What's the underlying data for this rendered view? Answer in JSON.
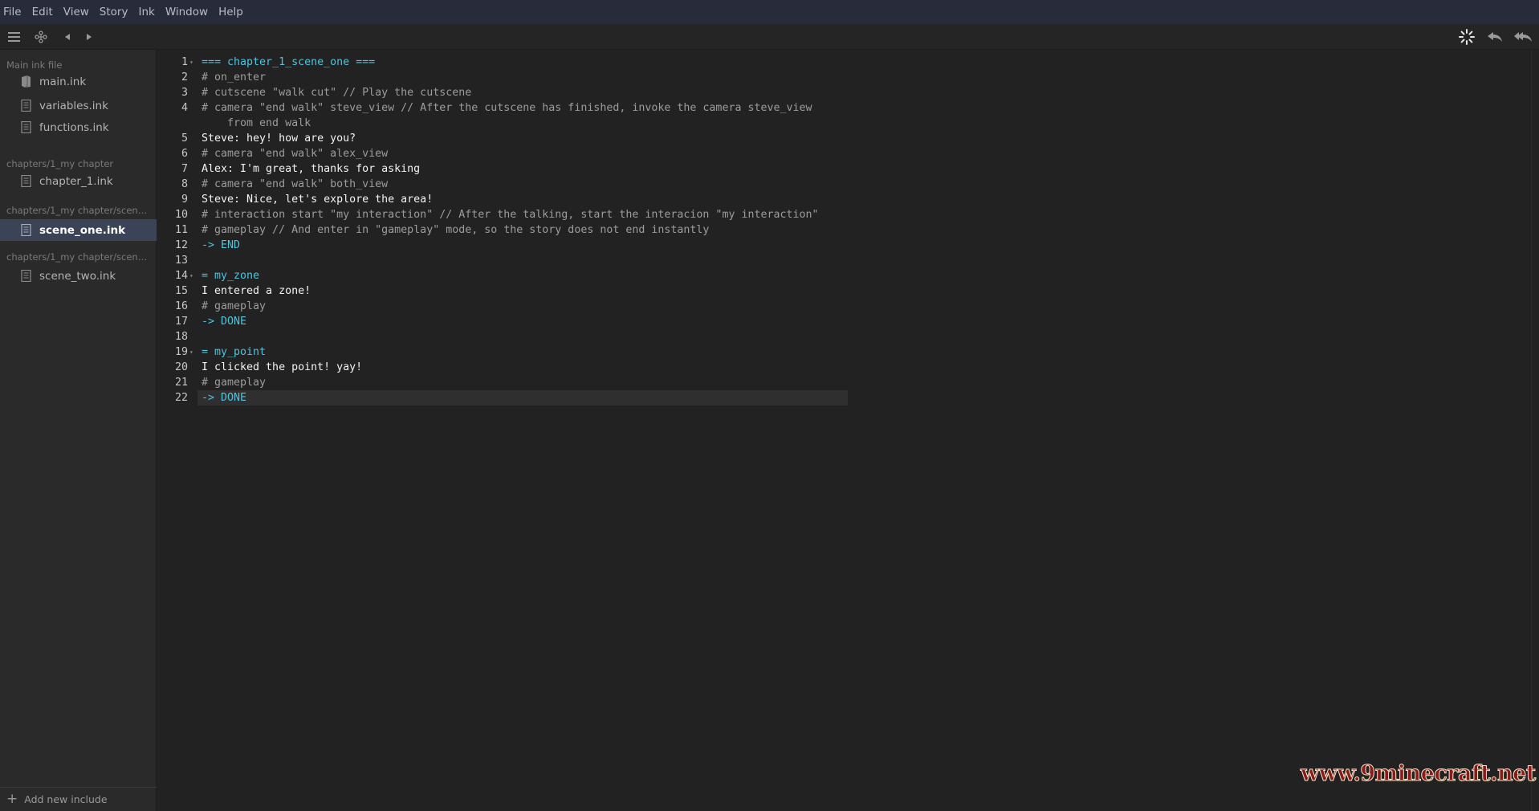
{
  "menubar": {
    "items": [
      "File",
      "Edit",
      "View",
      "Story",
      "Ink",
      "Window",
      "Help"
    ]
  },
  "toolbar": {
    "left_icons": [
      "hamburger-menu-icon",
      "navigation-graph-icon",
      "back-arrow-icon",
      "forward-arrow-icon"
    ],
    "right_icons": [
      "loading-spinner-icon",
      "rewind-one-icon",
      "rewind-all-icon"
    ]
  },
  "sidebar": {
    "groups": [
      {
        "label": "Main ink file",
        "files": [
          {
            "name": "main.ink",
            "icon": "main-file-icon",
            "active": false
          }
        ]
      },
      {
        "label": "",
        "files": [
          {
            "name": "variables.ink",
            "icon": "file-icon",
            "active": false
          },
          {
            "name": "functions.ink",
            "icon": "file-icon",
            "active": false
          }
        ]
      },
      {
        "label": "chapters/1_my chapter",
        "files": [
          {
            "name": "chapter_1.ink",
            "icon": "file-icon",
            "active": false
          }
        ]
      },
      {
        "label": "chapters/1_my chapter/scenes…",
        "files": [
          {
            "name": "scene_one.ink",
            "icon": "file-icon",
            "active": true
          }
        ]
      },
      {
        "label": "chapters/1_my chapter/scenes…",
        "files": [
          {
            "name": "scene_two.ink",
            "icon": "file-icon",
            "active": false
          }
        ]
      }
    ],
    "add_include_label": "Add new include"
  },
  "editor": {
    "lines": [
      {
        "n": "1",
        "fold": true,
        "type": "knot",
        "text": "=== chapter_1_scene_one ==="
      },
      {
        "n": "2",
        "type": "tag",
        "text": "# on_enter"
      },
      {
        "n": "3",
        "type": "tag",
        "text": "# cutscene \"walk cut\" // Play the cutscene"
      },
      {
        "n": "4",
        "type": "tag",
        "text": "# camera \"end walk\" steve_view // After the cutscene has finished, invoke the camera steve_view"
      },
      {
        "n": "",
        "type": "tag",
        "text": "    from end walk"
      },
      {
        "n": "5",
        "type": "text",
        "text": "Steve: hey! how are you?"
      },
      {
        "n": "6",
        "type": "tag",
        "text": "# camera \"end walk\" alex_view"
      },
      {
        "n": "7",
        "type": "text",
        "text": "Alex: I'm great, thanks for asking"
      },
      {
        "n": "8",
        "type": "tag",
        "text": "# camera \"end walk\" both_view"
      },
      {
        "n": "9",
        "type": "text",
        "text": "Steve: Nice, let's explore the area!"
      },
      {
        "n": "10",
        "type": "tag",
        "text": "# interaction start \"my interaction\" // After the talking, start the interacion \"my interaction\""
      },
      {
        "n": "11",
        "type": "tag",
        "text": "# gameplay // And enter in \"gameplay\" mode, so the story does not end instantly"
      },
      {
        "n": "12",
        "type": "divert",
        "text": "-> END"
      },
      {
        "n": "13",
        "type": "text",
        "text": ""
      },
      {
        "n": "14",
        "fold": true,
        "type": "knot",
        "text": "= my_zone"
      },
      {
        "n": "15",
        "type": "text",
        "text": "I entered a zone!"
      },
      {
        "n": "16",
        "type": "tag",
        "text": "# gameplay"
      },
      {
        "n": "17",
        "type": "divert",
        "text": "-> DONE"
      },
      {
        "n": "18",
        "type": "text",
        "text": ""
      },
      {
        "n": "19",
        "fold": true,
        "type": "knot",
        "text": "= my_point"
      },
      {
        "n": "20",
        "type": "text",
        "text": "I clicked the point! yay!"
      },
      {
        "n": "21",
        "type": "tag",
        "text": "# gameplay"
      },
      {
        "n": "22",
        "type": "divert",
        "text": "-> DONE",
        "current": true
      }
    ]
  },
  "watermark": "www.9minecraft.net",
  "colors": {
    "menubar_bg": "#272b3a",
    "sidebar_bg": "#2a2a2a",
    "editor_bg": "#222222",
    "active_file_bg": "#3b4356",
    "knot": "#4fc4dd",
    "tag": "#9c9c9c",
    "text": "#f2f2f2",
    "watermark": "#8b1a1a"
  }
}
